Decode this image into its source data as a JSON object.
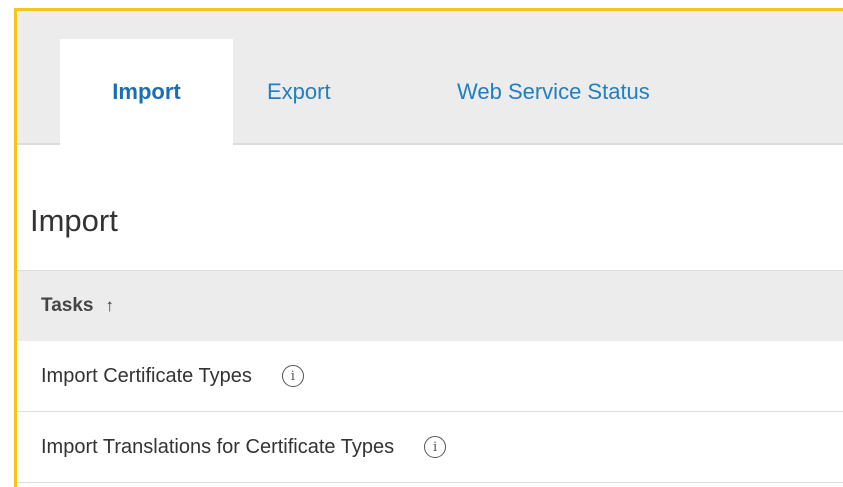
{
  "tabs": {
    "import_label": "Import",
    "export_label": "Export",
    "web_service_status_label": "Web Service Status"
  },
  "page_title": "Import",
  "table": {
    "column_header": "Tasks",
    "sort_icon": "↑",
    "rows": [
      {
        "label": "Import Certificate Types",
        "info_icon": "i"
      },
      {
        "label": "Import Translations for Certificate Types",
        "info_icon": "i"
      }
    ]
  },
  "colors": {
    "accent_border": "#f5c518",
    "tab_link": "#1f7fc0",
    "tab_bar_bg": "#ececec"
  }
}
